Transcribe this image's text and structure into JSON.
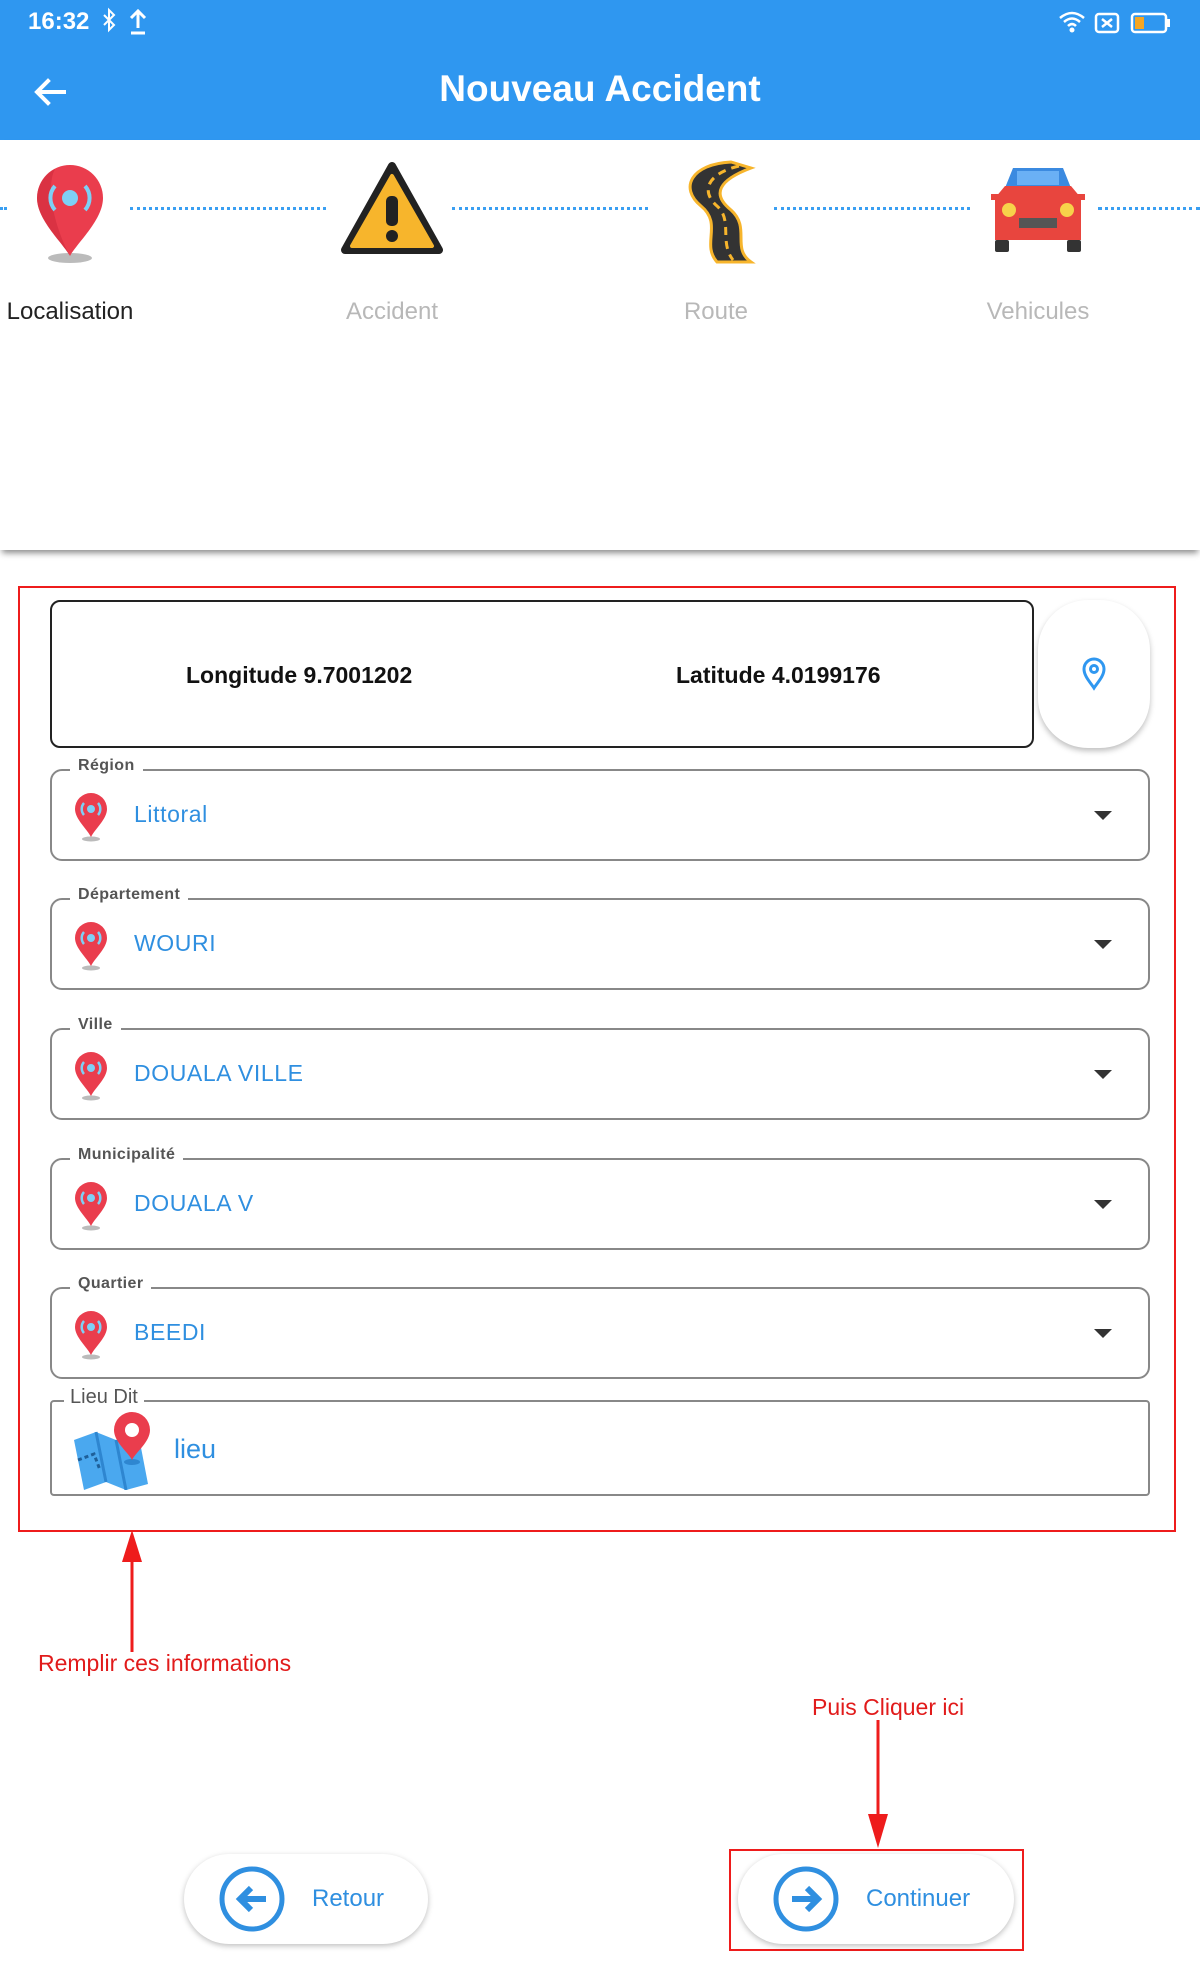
{
  "status": {
    "time": "16:32"
  },
  "appbar": {
    "title": "Nouveau Accident"
  },
  "steps": [
    {
      "label": "Localisation",
      "icon": "location-pin-icon",
      "active": true
    },
    {
      "label": "Accident",
      "icon": "warning-triangle-icon",
      "active": false
    },
    {
      "label": "Route",
      "icon": "road-icon",
      "active": false
    },
    {
      "label": "Vehicules",
      "icon": "car-icon",
      "active": false
    }
  ],
  "coords": {
    "longitude": "Longitude 9.7001202",
    "latitude": "Latitude 4.0199176"
  },
  "fields": {
    "region": {
      "label": "Région",
      "value": "Littoral"
    },
    "departement": {
      "label": "Département",
      "value": "WOURI"
    },
    "ville": {
      "label": "Ville",
      "value": "DOUALA VILLE"
    },
    "municipalite": {
      "label": "Municipalité",
      "value": "DOUALA V"
    },
    "quartier": {
      "label": "Quartier",
      "value": "BEEDI"
    }
  },
  "lieu": {
    "label": "Lieu Dit",
    "placeholder": "lieu"
  },
  "annotations": {
    "fill": "Remplir ces informations",
    "click": "Puis Cliquer ici"
  },
  "buttons": {
    "retour": "Retour",
    "continuer": "Continuer"
  },
  "colors": {
    "primary": "#2f97f0",
    "accent_text": "#2f8fe0",
    "annotation": "#ee1c1c",
    "pin": "#ea3d4d"
  }
}
